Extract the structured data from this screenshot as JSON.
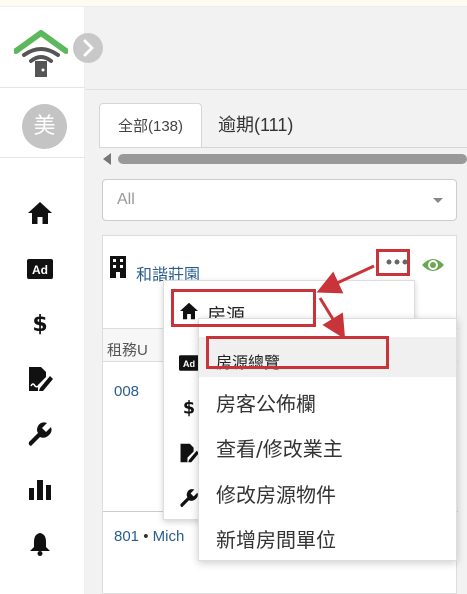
{
  "sidebar": {
    "avatar_text": "美",
    "icons": [
      "home-icon",
      "ad-icon",
      "dollar-icon",
      "signature-icon",
      "wrench-icon",
      "bar-chart-icon",
      "bell-icon"
    ]
  },
  "tabs": [
    {
      "label": "全部(138)",
      "active": true
    },
    {
      "label": "逾期(111)",
      "active": false
    }
  ],
  "filter": {
    "selected": "All"
  },
  "property": {
    "name": "和諧莊園",
    "column_header": "租務U",
    "row1_link": "008",
    "row2_link": "801",
    "row2_dot": " • ",
    "row2_name": "Mich"
  },
  "menu1": {
    "items": [
      {
        "label": "房源",
        "icon": "home-icon"
      }
    ]
  },
  "menu2": {
    "items": [
      {
        "label": "房源總覽"
      },
      {
        "label": "房客公佈欄"
      },
      {
        "label": "查看/修改業主"
      },
      {
        "label": "修改房源物件"
      },
      {
        "label": "新增房間單位"
      }
    ]
  },
  "colors": {
    "accent_green": "#6aa84f",
    "link_blue": "#2a5d8f",
    "highlight_red": "#c9343a"
  }
}
